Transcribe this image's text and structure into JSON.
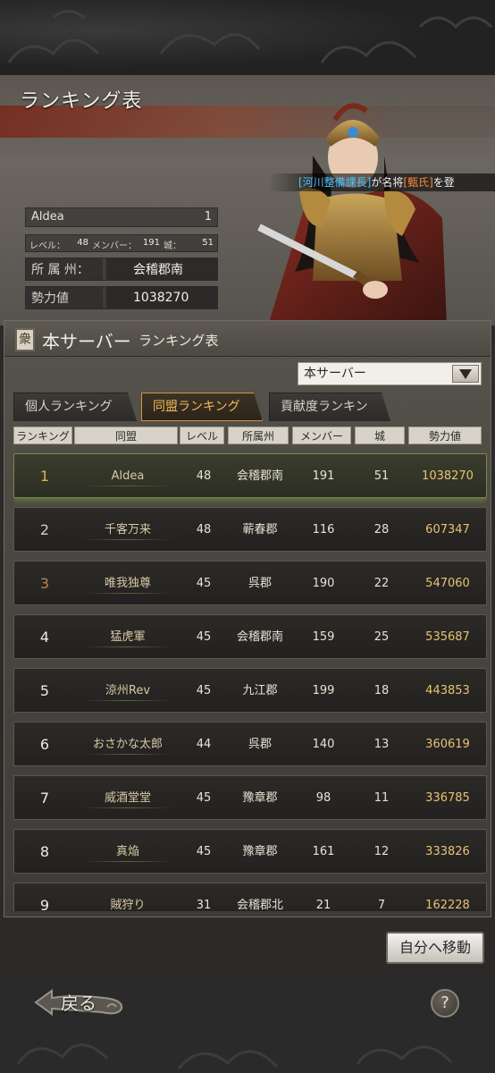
{
  "header": {
    "title": "ランキング表",
    "ticker": {
      "prefix": "[河川整備課長]",
      "mid": "が名将",
      "name": "[甄氏]",
      "suffix": "を登"
    }
  },
  "alliance_info": {
    "name": "Aldea",
    "rank": "1",
    "level_label": "レベル：",
    "level": "48",
    "members_label": "メンバー：",
    "members": "191",
    "castles_label": "城：",
    "castles": "51",
    "prefecture_label": "所 属 州：",
    "prefecture": "会稽郡南",
    "power_label": "勢力値",
    "power": "1038270"
  },
  "panel": {
    "icon": "衆",
    "title": "本サーバー",
    "subtitle": "ランキング表",
    "dropdown_value": "本サーバー",
    "tabs": [
      {
        "label": "個人ランキング",
        "active": false
      },
      {
        "label": "同盟ランキング",
        "active": true
      },
      {
        "label": "貢献度ランキング",
        "active": false
      }
    ],
    "columns": [
      "ランキング",
      "同盟",
      "レベル",
      "所属州",
      "メンバー",
      "城",
      "勢力値"
    ]
  },
  "rows": [
    {
      "rank": "1",
      "name": "Aldea",
      "level": "48",
      "state": "会稽郡南",
      "members": "191",
      "castles": "51",
      "power": "1038270"
    },
    {
      "rank": "2",
      "name": "千客万来",
      "level": "48",
      "state": "蕲春郡",
      "members": "116",
      "castles": "28",
      "power": "607347"
    },
    {
      "rank": "3",
      "name": "唯我独尊",
      "level": "45",
      "state": "呉郡",
      "members": "190",
      "castles": "22",
      "power": "547060"
    },
    {
      "rank": "4",
      "name": "猛虎軍",
      "level": "45",
      "state": "会稽郡南",
      "members": "159",
      "castles": "25",
      "power": "535687"
    },
    {
      "rank": "5",
      "name": "涼州Rev",
      "level": "45",
      "state": "九江郡",
      "members": "199",
      "castles": "18",
      "power": "443853"
    },
    {
      "rank": "6",
      "name": "おさかな太郎",
      "level": "44",
      "state": "呉郡",
      "members": "140",
      "castles": "13",
      "power": "360619"
    },
    {
      "rank": "7",
      "name": "威酒堂堂",
      "level": "45",
      "state": "豫章郡",
      "members": "98",
      "castles": "11",
      "power": "336785"
    },
    {
      "rank": "8",
      "name": "真焔",
      "level": "45",
      "state": "豫章郡",
      "members": "161",
      "castles": "12",
      "power": "333826"
    },
    {
      "rank": "9",
      "name": "賊狩り",
      "level": "31",
      "state": "会稽郡北",
      "members": "21",
      "castles": "7",
      "power": "162228"
    }
  ],
  "buttons": {
    "move_to_self": "自分へ移動",
    "back": "戻る",
    "help": "?"
  },
  "icons": {
    "dropdown": "triangle-down-icon",
    "help": "question-icon",
    "back": "cloud-back-icon"
  }
}
